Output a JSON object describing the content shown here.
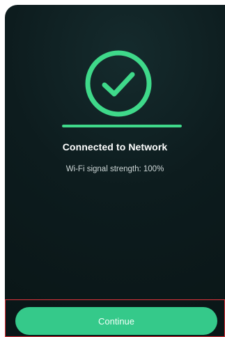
{
  "status": {
    "title": "Connected to Network",
    "signal_text": "Wi-Fi signal strength: 100%",
    "progress_fraction": 1.0
  },
  "actions": {
    "continue_label": "Continue"
  },
  "icons": {
    "success": "check-circle-icon"
  },
  "colors": {
    "accent": "#3fd98a",
    "button": "#35c98a",
    "background": "#0d1c1e"
  }
}
